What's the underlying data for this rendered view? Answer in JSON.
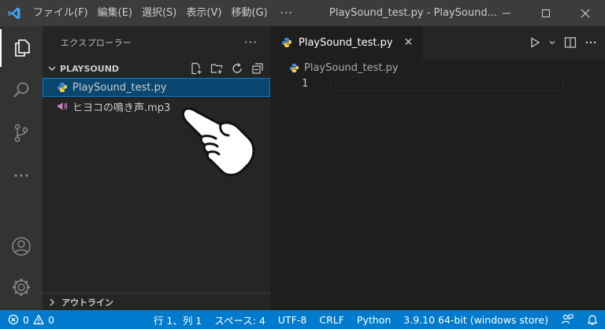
{
  "menu": {
    "file": "ファイル(F)",
    "edit": "編集(E)",
    "selection": "選択(S)",
    "view": "表示(V)",
    "go": "移動(G)",
    "more": "···"
  },
  "window_title": "PlaySound_test.py - PlaySound...",
  "sidebar": {
    "title": "エクスプローラー",
    "more": "···",
    "folder": "PLAYSOUND",
    "files": [
      {
        "name": "PlaySound_test.py",
        "icon": "python-icon"
      },
      {
        "name": "ヒヨコの鳴き声.mp3",
        "icon": "audio-icon"
      }
    ],
    "outline": "アウトライン"
  },
  "editor": {
    "tab_label": "PlaySound_test.py",
    "tab_close": "✕",
    "breadcrumb": "PlaySound_test.py",
    "line_number": "1"
  },
  "statusbar": {
    "errors": "0",
    "warnings": "0",
    "position": "行 1、列 1",
    "spaces": "スペース: 4",
    "encoding": "UTF-8",
    "eol": "CRLF",
    "language": "Python",
    "interpreter": "3.9.10 64-bit (windows store)"
  },
  "colors": {
    "accent": "#007acc",
    "selection": "#094771",
    "python_blue": "#3572a5",
    "python_yellow": "#ffd43b",
    "audio_purple": "#c586c0"
  }
}
